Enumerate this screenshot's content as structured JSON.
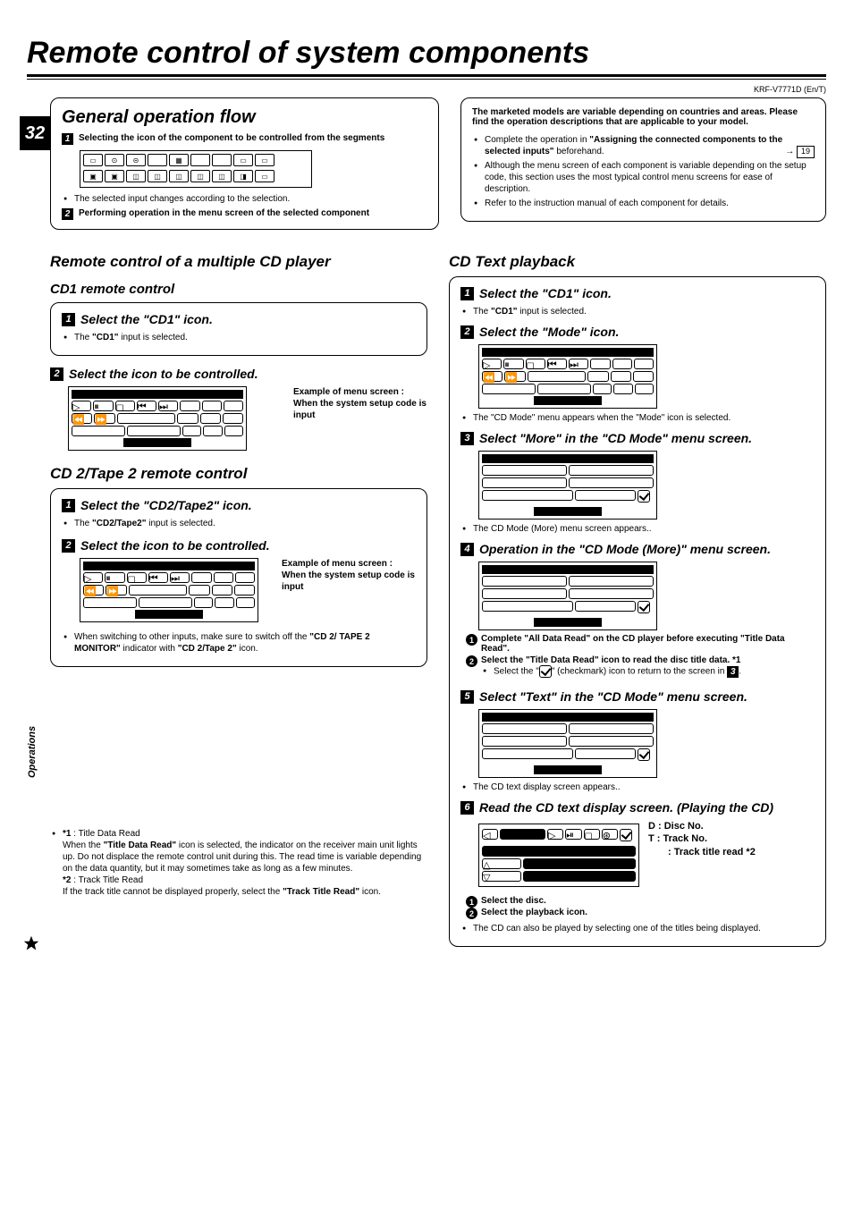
{
  "doc": {
    "title": "Remote control of system components",
    "model": "KRF-V7771D (En/T)",
    "page": "32",
    "side_label": "Operations"
  },
  "general": {
    "heading": "General operation flow",
    "step1": "Selecting the icon of the component to be controlled from the segments",
    "step1_note": "The selected input changes according to the selection.",
    "step2": "Performing operation in the menu screen of the selected component"
  },
  "market_note": "The marketed models are variable depending on countries and areas. Please find the operation descriptions that are applicable to your model.",
  "market_bullets": {
    "b1a": "Complete the operation in ",
    "b1b": "\"Assigning the connected components to the selected inputs\"",
    "b1c": " beforehand.",
    "b1_page": "19",
    "b2": "Although the menu screen of each component is variable depending on the setup code, this section uses the most typical control menu screens for ease of description.",
    "b3": "Refer to the instruction manual of each component for details."
  },
  "multi_cd": {
    "heading": "Remote control of a multiple CD player",
    "cd1_heading": "CD1 remote control",
    "step1": "Select the \"CD1\" icon.",
    "step1_note_a": "The ",
    "step1_note_b": "\"CD1\"",
    "step1_note_c": " input is selected.",
    "step2": "Select the icon to be controlled.",
    "example": "Example of menu screen : When the system setup code is input"
  },
  "cd2tape": {
    "heading": "CD 2/Tape 2 remote control",
    "step1": "Select the \"CD2/Tape2\" icon.",
    "step1_note_a": "The ",
    "step1_note_b": "\"CD2/Tape2\"",
    "step1_note_c": " input is selected.",
    "step2": "Select the icon to be controlled.",
    "example": "Example of menu screen : When the system setup code is input",
    "switch_note_a": "When switching to other inputs, make sure to switch off the ",
    "switch_note_b": "\"CD 2/ TAPE 2 MONITOR\"",
    "switch_note_c": " indicator with ",
    "switch_note_d": "\"CD 2/Tape 2\"",
    "switch_note_e": " icon."
  },
  "cdtext": {
    "heading": "CD Text playback",
    "s1": "Select the \"CD1\" icon.",
    "s1_note_a": "The ",
    "s1_note_b": "\"CD1\"",
    "s1_note_c": " input is selected.",
    "s2": "Select the \"Mode\" icon.",
    "s2_note": "The \"CD Mode\" menu appears when the \"Mode\" icon is selected.",
    "s3": "Select \"More\" in the \"CD Mode\" menu screen.",
    "s3_note": "The CD Mode (More) menu screen appears..",
    "s4": "Operation in the \"CD Mode (More)\" menu screen.",
    "s4_c1": "Complete \"All Data Read\" on the CD player before executing \"Title Data Read\".",
    "s4_c2": "Select the \"Title Data Read\" icon to read  the disc title data. *1",
    "s4_c2_note_a": "Select the \"",
    "s4_c2_note_b": "\" (checkmark) icon to return to the screen in ",
    "s4_c2_note_c": ".",
    "s5": "Select \"Text\" in the \"CD Mode\" menu screen.",
    "s5_note": "The CD text display screen appears..",
    "s6": "Read the CD text display screen. (Playing the CD)",
    "legend_D": "D   : Disc No.",
    "legend_T": "T    : Track No.",
    "legend_title": ": Track title read *2",
    "c1": "Select the disc.",
    "c2": "Select the playback icon.",
    "final_note": "The CD can also be played by selecting one of the titles being displayed."
  },
  "footnotes": {
    "f1_label": "*1",
    "f1_name": " : Title Data Read",
    "f1_body_a": "When the ",
    "f1_body_b": "\"Title Data Read\"",
    "f1_body_c": " icon is selected, the indicator on the receiver main unit lights up. Do not displace the remote control unit during this. The read time is variable depending on the data quantity, but it may sometimes take as long as a few minutes.",
    "f2_label": "*2",
    "f2_name": " : Track Title Read",
    "f2_body_a": "If the track title cannot be displayed properly, select the ",
    "f2_body_b": "\"Track Title Read\"",
    "f2_body_c": " icon."
  }
}
